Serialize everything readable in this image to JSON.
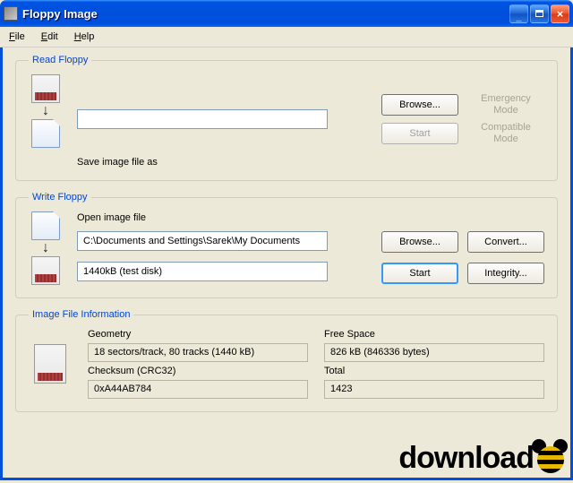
{
  "window": {
    "title": "Floppy Image"
  },
  "menu": {
    "file": "File",
    "edit": "Edit",
    "help": "Help"
  },
  "read": {
    "legend": "Read Floppy",
    "save_label": "Save image file as",
    "save_value": "",
    "browse": "Browse...",
    "start": "Start",
    "emergency": "Emergency Mode",
    "compatible": "Compatible Mode"
  },
  "write": {
    "legend": "Write Floppy",
    "open_label": "Open image file",
    "open_value": "C:\\Documents and Settings\\Sarek\\My Documents",
    "disk_value": "1440kB (test disk)",
    "browse": "Browse...",
    "convert": "Convert...",
    "start": "Start",
    "integrity": "Integrity..."
  },
  "info": {
    "legend": "Image File Information",
    "geometry_label": "Geometry",
    "geometry_value": "18 sectors/track, 80 tracks (1440 kB)",
    "free_label": "Free Space",
    "free_value": "826 kB (846336 bytes)",
    "checksum_label": "Checksum (CRC32)",
    "checksum_value": "0xA44AB784",
    "total_label": "Total",
    "total_value": "1423"
  },
  "watermark": {
    "text": "download"
  }
}
